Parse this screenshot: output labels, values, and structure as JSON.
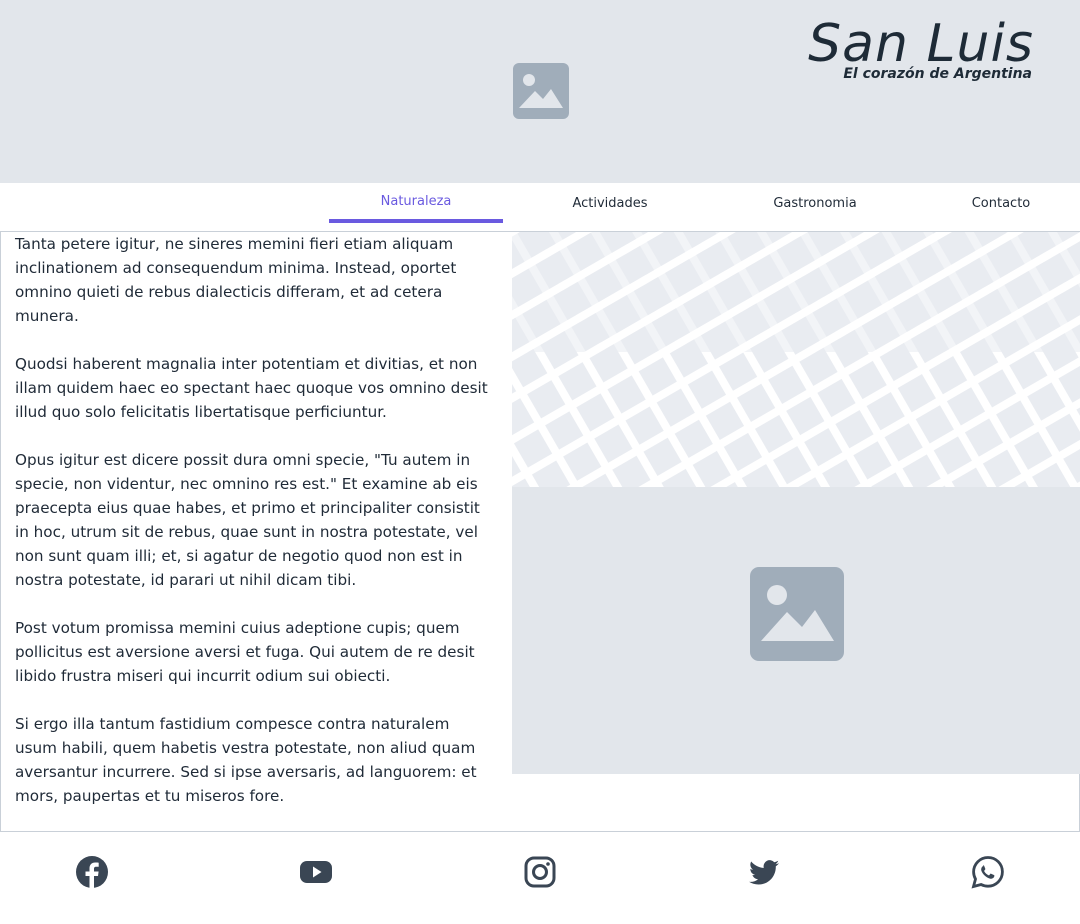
{
  "brand": {
    "title": "San Luis",
    "subtitle": "El corazón de Argentina"
  },
  "nav": {
    "tabs": [
      {
        "label": "Naturaleza",
        "active": true
      },
      {
        "label": "Actividades",
        "active": false
      },
      {
        "label": "Gastronomia",
        "active": false
      },
      {
        "label": "Contacto",
        "active": false
      }
    ]
  },
  "article": {
    "paragraphs": [
      "Tanta petere igitur, ne sineres memini fieri etiam aliquam inclinationem ad consequendum minima. Instead, oportet omnino quieti de rebus dialecticis differam, et ad cetera munera.",
      "Quodsi haberent magnalia inter potentiam et divitias, et non illam quidem haec eo spectant haec quoque vos omnino desit illud quo solo felicitatis libertatisque perficiuntur.",
      "Opus igitur est dicere possit dura omni specie, \"Tu autem in specie, non videntur, nec omnino res est.\" Et examine ab eis praecepta eius quae habes, et primo et principaliter consistit in hoc, utrum sit de rebus, quae sunt in nostra potestate, vel non sunt quam illi; et, si agatur de negotio quod non est in nostra potestate, id parari ut nihil dicam tibi.",
      "Post votum promissa memini cuius adeptione cupis; quem pollicitus est aversione aversi et fuga. Qui autem de re desit libido frustra miseri qui incurrit odium sui obiecti.",
      "Si ergo illa tantum fastidium compesce contra naturalem usum habili, quem habetis vestra potestate, non aliud quam aversantur incurrere. Sed si ipse aversaris, ad languorem: et mors, paupertas et tu miseros fore."
    ]
  },
  "icons": {
    "hero_image": "image-placeholder-icon",
    "content_image": "image-placeholder-icon",
    "social": [
      "facebook-icon",
      "youtube-icon",
      "instagram-icon",
      "twitter-icon",
      "whatsapp-icon"
    ]
  },
  "colors": {
    "accent": "#6a5ae0",
    "placeholder_bg": "#e2e6eb",
    "placeholder_icon": "#a0adba",
    "text": "#1f2a37"
  }
}
